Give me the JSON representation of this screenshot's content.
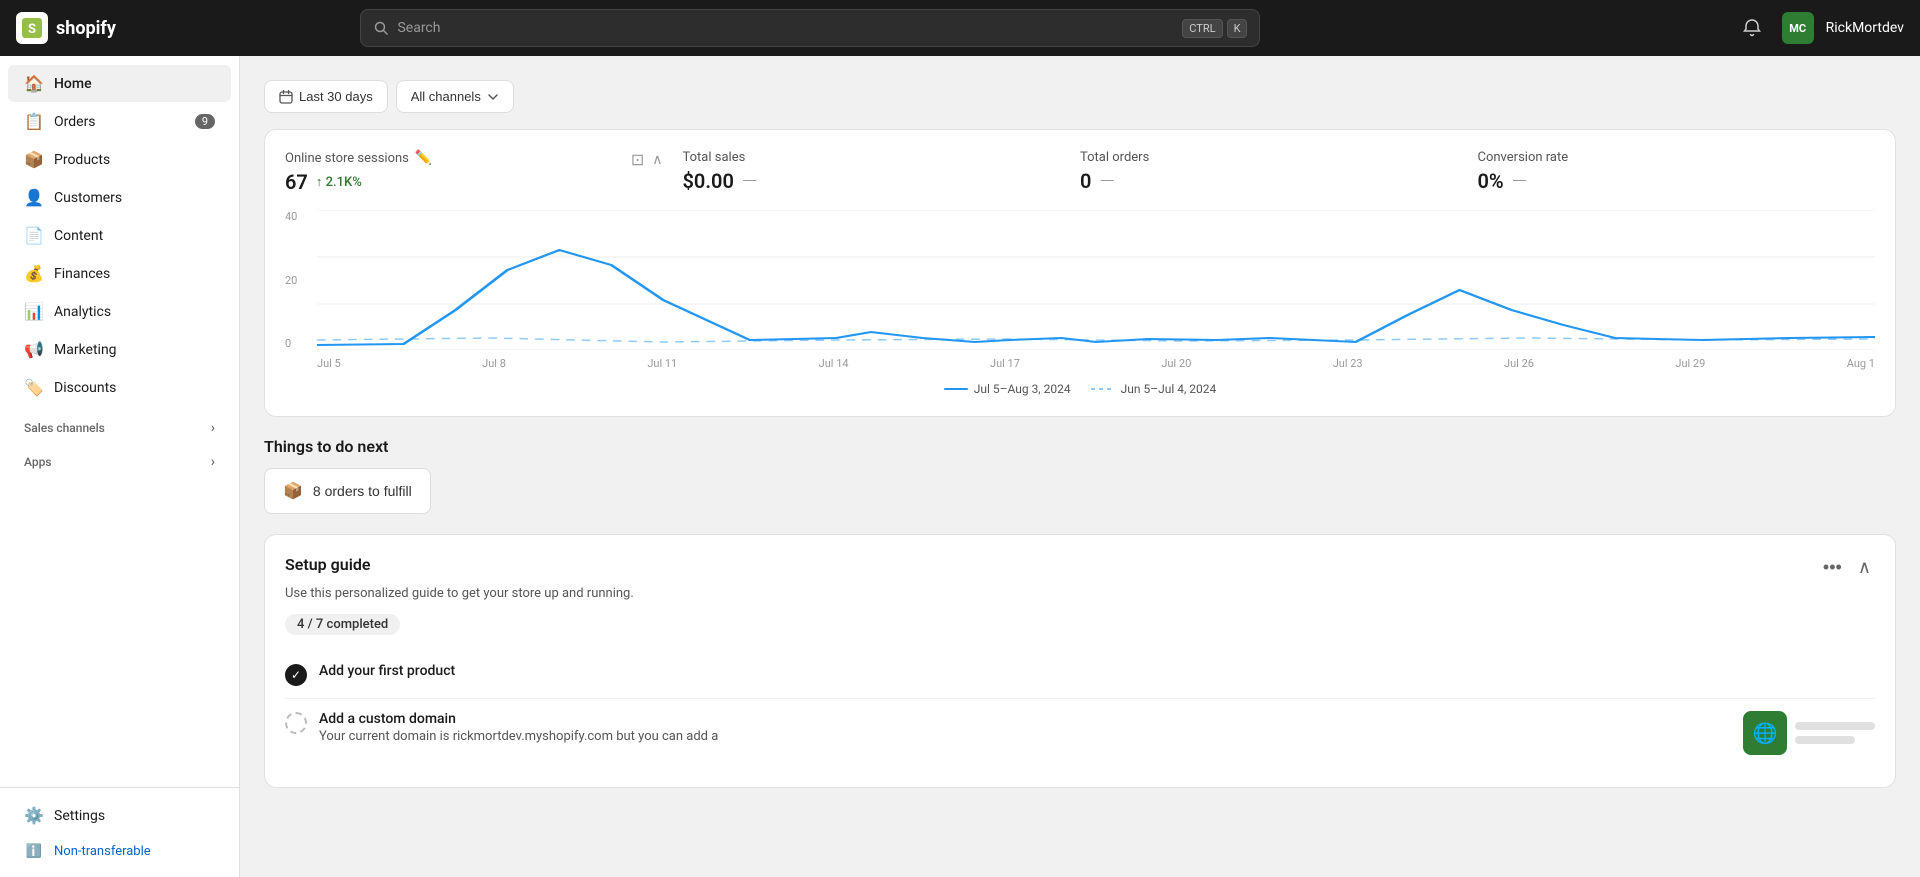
{
  "topnav": {
    "logo_text": "shopify",
    "search_placeholder": "Search",
    "shortcut_ctrl": "CTRL",
    "shortcut_k": "K",
    "user_initials": "MC",
    "user_name": "RickMortdev"
  },
  "sidebar": {
    "nav_items": [
      {
        "id": "home",
        "label": "Home",
        "icon": "🏠",
        "active": true
      },
      {
        "id": "orders",
        "label": "Orders",
        "icon": "📋",
        "badge": "9"
      },
      {
        "id": "products",
        "label": "Products",
        "icon": "📦"
      },
      {
        "id": "customers",
        "label": "Customers",
        "icon": "👤"
      },
      {
        "id": "content",
        "label": "Content",
        "icon": "📄"
      },
      {
        "id": "finances",
        "label": "Finances",
        "icon": "💰"
      },
      {
        "id": "analytics",
        "label": "Analytics",
        "icon": "📊"
      },
      {
        "id": "marketing",
        "label": "Marketing",
        "icon": "📢"
      },
      {
        "id": "discounts",
        "label": "Discounts",
        "icon": "🏷️"
      }
    ],
    "sales_channels_label": "Sales channels",
    "apps_label": "Apps",
    "settings_label": "Settings",
    "non_transferable_label": "Non-transferable"
  },
  "filters": {
    "date_range": "Last 30 days",
    "channel": "All channels"
  },
  "analytics": {
    "metrics": [
      {
        "label": "Online store sessions",
        "value": "67",
        "change": "↑ 2.1K%",
        "secondary": ""
      },
      {
        "label": "Total sales",
        "value": "$0.00",
        "dash": "—"
      },
      {
        "label": "Total orders",
        "value": "0",
        "dash": "—"
      },
      {
        "label": "Conversion rate",
        "value": "0%",
        "dash": "—"
      }
    ],
    "chart": {
      "y_labels": [
        "40",
        "20",
        "0"
      ],
      "x_labels": [
        "Jul 5",
        "Jul 8",
        "Jul 11",
        "Jul 14",
        "Jul 17",
        "Jul 20",
        "Jul 23",
        "Jul 26",
        "Jul 29",
        "Aug 1"
      ],
      "legend_current": "Jul 5–Aug 3, 2024",
      "legend_previous": "Jun 5–Jul 4, 2024"
    }
  },
  "things_to_do": {
    "section_title": "Things to do next",
    "orders_to_fulfill": "8 orders to fulfill"
  },
  "setup_guide": {
    "title": "Setup guide",
    "subtitle": "Use this personalized guide to get your store up and running.",
    "progress": "4 / 7 completed",
    "tasks": [
      {
        "id": "add-product",
        "label": "Add your first product",
        "done": true,
        "desc": ""
      },
      {
        "id": "custom-domain",
        "label": "Add a custom domain",
        "done": false,
        "desc": "Your current domain is rickmortdev.myshopify.com but you can add a"
      }
    ]
  }
}
